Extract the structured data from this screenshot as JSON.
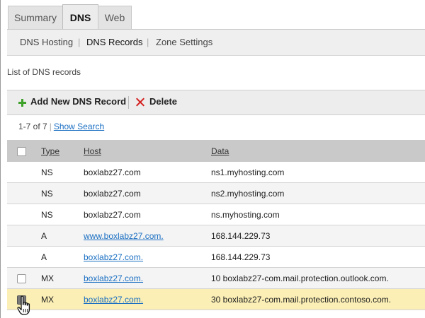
{
  "tabs": [
    {
      "label": "Summary"
    },
    {
      "label": "DNS"
    },
    {
      "label": "Web"
    }
  ],
  "subnav": {
    "items": [
      "DNS Hosting",
      "DNS Records",
      "Zone Settings"
    ],
    "separator": "|"
  },
  "description": "List of DNS records",
  "toolbar": {
    "add_label": "Add New DNS Record",
    "delete_label": "Delete",
    "add_icon": "plus-icon",
    "delete_icon": "x-icon"
  },
  "pager": {
    "range": "1-7 of 7",
    "separator": "|",
    "show_search": "Show Search"
  },
  "table": {
    "headers": {
      "type": "Type",
      "host": "Host",
      "data": "Data"
    },
    "rows": [
      {
        "type": "NS",
        "host": "boxlabz27.com",
        "data": "ns1.myhosting.com",
        "host_link": false,
        "checkbox": false
      },
      {
        "type": "NS",
        "host": "boxlabz27.com",
        "data": "ns2.myhosting.com",
        "host_link": false,
        "checkbox": false
      },
      {
        "type": "NS",
        "host": "boxlabz27.com",
        "data": "ns.myhosting.com",
        "host_link": false,
        "checkbox": false
      },
      {
        "type": "A",
        "host": "www.boxlabz27.com.",
        "data": "168.144.229.73",
        "host_link": true,
        "checkbox": false
      },
      {
        "type": "A",
        "host": "boxlabz27.com.",
        "data": "168.144.229.73",
        "host_link": true,
        "checkbox": false
      },
      {
        "type": "MX",
        "host": "boxlabz27.com.",
        "data": "10 boxlabz27-com.mail.protection.outlook.com.",
        "host_link": true,
        "checkbox": true,
        "checked": false
      },
      {
        "type": "MX",
        "host": "boxlabz27.com.",
        "data": "30 boxlabz27-com.mail.protection.contoso.com.",
        "host_link": true,
        "checkbox": true,
        "checked": true
      }
    ]
  },
  "colors": {
    "link": "#1a6fc2",
    "selected_row": "#fbefb5",
    "header_bg": "#c9c9c9",
    "add_icon": "#3ea12a",
    "delete_icon": "#d42020"
  }
}
